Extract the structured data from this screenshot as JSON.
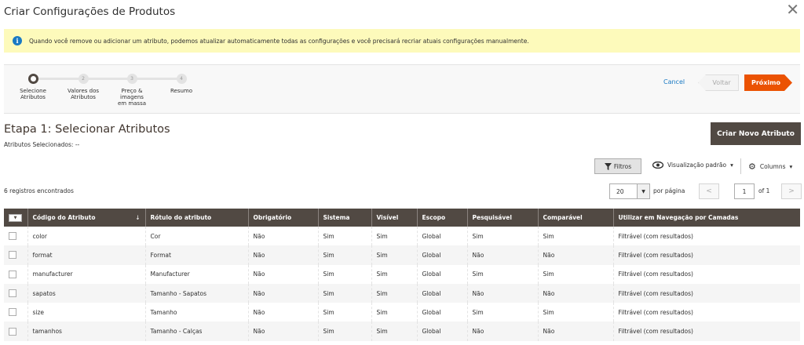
{
  "modal": {
    "title": "Criar Configurações de Produtos",
    "close": "✕"
  },
  "notice": {
    "icon": "info-icon",
    "text": "Quando você remove ou adicionar um atributo, podemos atualizar automaticamente todas as configurações e você precisará recriar atuais configurações manualmente."
  },
  "steps": [
    {
      "number": "1",
      "label": "Selecione Atributos",
      "active": true
    },
    {
      "number": "2",
      "label": "Valores dos Atributos",
      "active": false
    },
    {
      "number": "3",
      "label": "Preço & imagens em massa",
      "active": false
    },
    {
      "number": "4",
      "label": "Resumo",
      "active": false
    }
  ],
  "nav": {
    "cancel": "Cancel",
    "back": "Voltar",
    "next": "Próximo"
  },
  "section": {
    "title": "Etapa 1: Selecionar Atributos",
    "selected": "Atributos Selecionados: --",
    "create_button": "Criar Novo Atributo"
  },
  "toolbar": {
    "filters": "Filtros",
    "view": "Visualização padrão",
    "columns": "Columns"
  },
  "pager": {
    "records": "6 registros encontrados",
    "per_page": "20",
    "per_page_label": "por página",
    "page": "1",
    "of": "of 1"
  },
  "table": {
    "headers": [
      "Código do Atributo",
      "Rótulo do atributo",
      "Obrigatório",
      "Sistema",
      "Visível",
      "Escopo",
      "Pesquisável",
      "Comparável",
      "Utilizar em Navegação por Camadas"
    ],
    "rows": [
      [
        "color",
        "Cor",
        "Não",
        "Sim",
        "Sim",
        "Global",
        "Sim",
        "Sim",
        "Filtrável (com resultados)"
      ],
      [
        "format",
        "Format",
        "Não",
        "Sim",
        "Sim",
        "Global",
        "Não",
        "Não",
        "Filtrável (com resultados)"
      ],
      [
        "manufacturer",
        "Manufacturer",
        "Não",
        "Sim",
        "Sim",
        "Global",
        "Sim",
        "Sim",
        "Filtrável (com resultados)"
      ],
      [
        "sapatos",
        "Tamanho - Sapatos",
        "Não",
        "Sim",
        "Sim",
        "Global",
        "Não",
        "Não",
        "Filtrável (com resultados)"
      ],
      [
        "size",
        "Tamanho",
        "Não",
        "Sim",
        "Sim",
        "Global",
        "Sim",
        "Sim",
        "Filtrável (com resultados)"
      ],
      [
        "tamanhos",
        "Tamanho - Calças",
        "Não",
        "Sim",
        "Sim",
        "Global",
        "Não",
        "Não",
        "Filtrável (com resultados)"
      ]
    ]
  },
  "colors": {
    "accent": "#eb5202",
    "header_bg": "#514943",
    "notice_bg": "#fdfabb",
    "link": "#1979c3"
  }
}
